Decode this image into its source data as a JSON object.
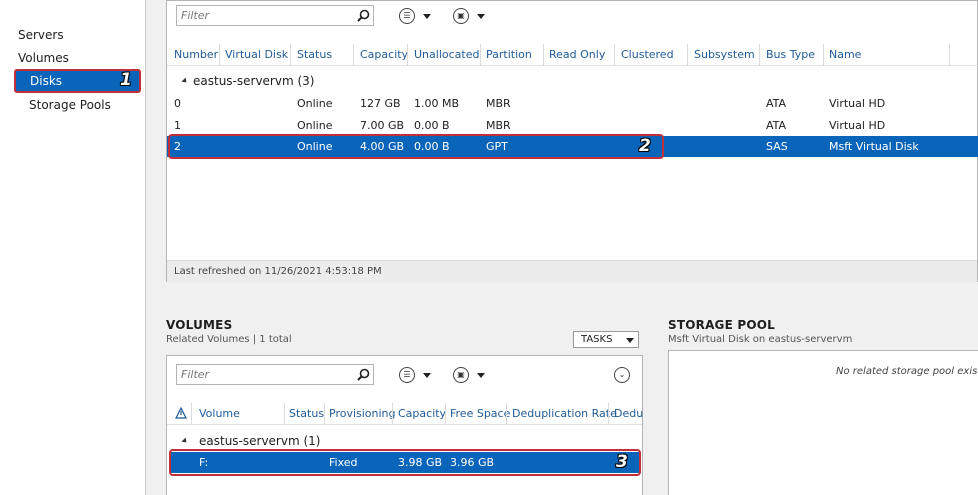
{
  "nav": {
    "items": [
      {
        "label": "Servers"
      },
      {
        "label": "Volumes"
      },
      {
        "label": "Disks"
      },
      {
        "label": "Storage Pools"
      }
    ]
  },
  "callouts": {
    "one": "1",
    "two": "2",
    "three": "3"
  },
  "disks": {
    "filter_placeholder": "Filter",
    "columns": [
      "Number",
      "Virtual Disk",
      "Status",
      "Capacity",
      "Unallocated",
      "Partition",
      "Read Only",
      "Clustered",
      "Subsystem",
      "Bus Type",
      "Name"
    ],
    "group_label": "eastus-servervm (3)",
    "rows": [
      {
        "number": "0",
        "status": "Online",
        "capacity": "127 GB",
        "unallocated": "1.00 MB",
        "partition": "MBR",
        "bus_type": "ATA",
        "name": "Virtual HD"
      },
      {
        "number": "1",
        "status": "Online",
        "capacity": "7.00 GB",
        "unallocated": "0.00 B",
        "partition": "MBR",
        "bus_type": "ATA",
        "name": "Virtual HD"
      },
      {
        "number": "2",
        "status": "Online",
        "capacity": "4.00 GB",
        "unallocated": "0.00 B",
        "partition": "GPT",
        "bus_type": "SAS",
        "name": "Msft Virtual Disk"
      }
    ],
    "last_refreshed": "Last refreshed on 11/26/2021 4:53:18 PM"
  },
  "volumes": {
    "title": "VOLUMES",
    "subtitle": "Related Volumes | 1 total",
    "tasks_label": "TASKS",
    "filter_placeholder": "Filter",
    "columns": [
      "Volume",
      "Status",
      "Provisioning",
      "Capacity",
      "Free Space",
      "Deduplication Rate",
      "Dedu"
    ],
    "group_label": "eastus-servervm (1)",
    "row": {
      "volume": "F:",
      "provisioning": "Fixed",
      "capacity": "3.98 GB",
      "free_space": "3.96 GB"
    }
  },
  "storage_pool": {
    "title": "STORAGE POOL",
    "subtitle": "Msft Virtual Disk on eastus-servervm",
    "empty_message": "No related storage pool exists."
  },
  "colors": {
    "selection": "#0a64b9",
    "highlight_border": "#c0303b",
    "header_text": "#1f5b97"
  }
}
